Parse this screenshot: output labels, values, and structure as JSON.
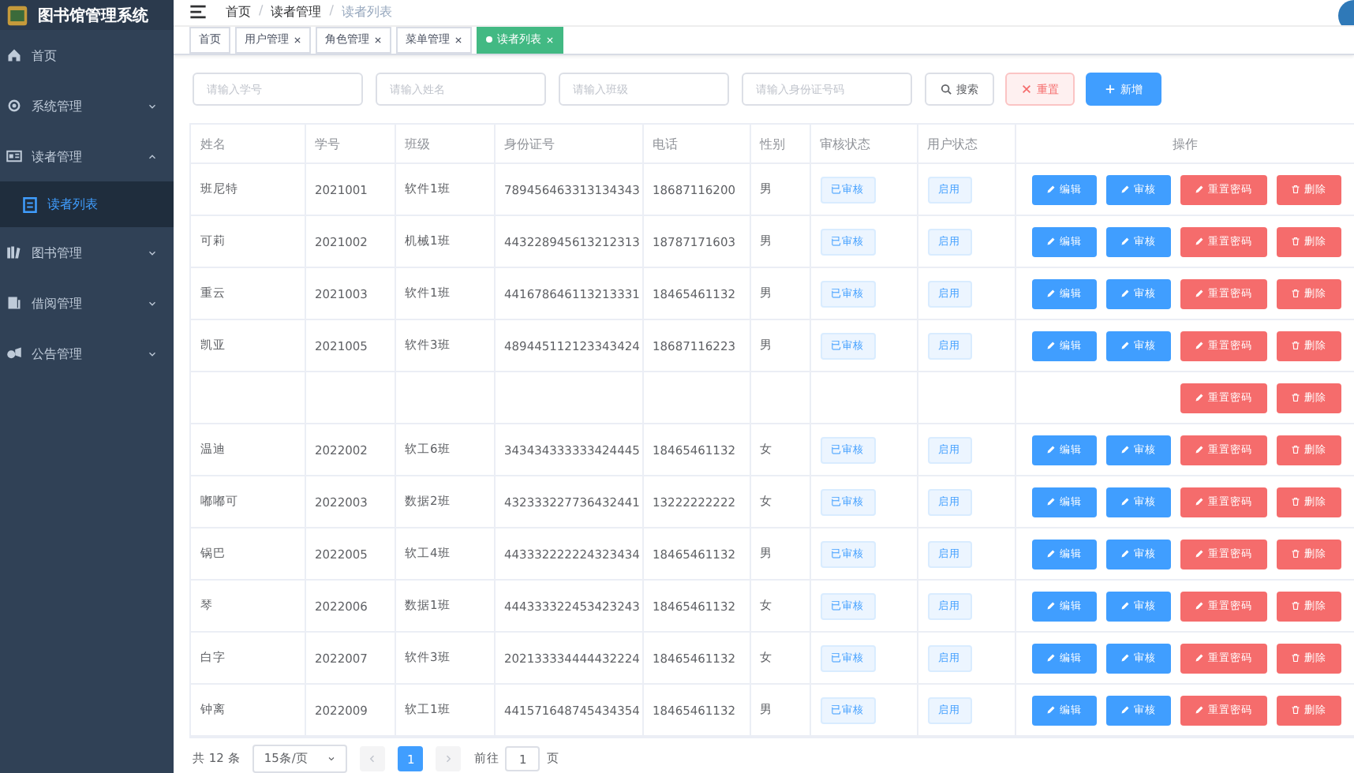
{
  "sidebar": {
    "title": "图书馆管理系统",
    "items": [
      {
        "label": "首页",
        "selected": false
      },
      {
        "label": "系统管理",
        "expanded": false,
        "selected": false
      },
      {
        "label": "读者管理",
        "expanded": true,
        "selected": false,
        "children": [
          {
            "label": "读者列表",
            "selected": true
          }
        ]
      },
      {
        "label": "图书管理",
        "expanded": false,
        "selected": false
      },
      {
        "label": "借阅管理",
        "expanded": false,
        "selected": false
      },
      {
        "label": "公告管理",
        "expanded": false,
        "selected": false
      }
    ]
  },
  "breadcrumb": [
    {
      "label": "首页"
    },
    {
      "separator": "/",
      "label": "读者管理"
    },
    {
      "separator": "/",
      "label": "读者列表"
    }
  ],
  "tabs": [
    {
      "label": "首页",
      "selected": false,
      "closable": false
    },
    {
      "label": "用户管理",
      "selected": false,
      "closable": true
    },
    {
      "label": "角色管理",
      "selected": false,
      "closable": true
    },
    {
      "label": "菜单管理",
      "selected": false,
      "closable": true
    },
    {
      "label": "读者列表",
      "selected": true,
      "closable": true
    }
  ],
  "search": {
    "fields": [
      {
        "placeholder": "请输入学号"
      },
      {
        "placeholder": "请输入姓名"
      },
      {
        "placeholder": "请输入班级"
      },
      {
        "placeholder": "请输入身份证号码"
      }
    ],
    "buttons": [
      {
        "kind": "search",
        "label": "搜索"
      },
      {
        "kind": "reset",
        "label": "重置"
      },
      {
        "kind": "add",
        "label": "新增"
      }
    ]
  },
  "table": {
    "columns": [
      "姓名",
      "学号",
      "班级",
      "身份证号",
      "电话",
      "性别",
      "审核状态",
      "用户状态",
      "操作"
    ],
    "rows": [
      {
        "cells": [
          "班尼特",
          "2021001",
          "软件1班",
          "789456463313134343",
          "18687116200",
          "男"
        ],
        "audit_status": "已审核",
        "user_status": "启用",
        "actions": [
          {
            "kind": "edit",
            "label": "编辑"
          },
          {
            "kind": "audit",
            "label": "审核"
          },
          {
            "kind": "reset",
            "label": "重置密码"
          },
          {
            "kind": "delete",
            "label": "删除"
          }
        ]
      },
      {
        "cells": [
          "可莉",
          "2021002",
          "机械1班",
          "443228945613212313",
          "18787171603",
          "男"
        ],
        "audit_status": "已审核",
        "user_status": "启用",
        "actions": [
          {
            "kind": "edit",
            "label": "编辑"
          },
          {
            "kind": "audit",
            "label": "审核"
          },
          {
            "kind": "reset",
            "label": "重置密码"
          },
          {
            "kind": "delete",
            "label": "删除"
          }
        ]
      },
      {
        "cells": [
          "重云",
          "2021003",
          "软件1班",
          "441678646113213331",
          "18465461132",
          "男"
        ],
        "audit_status": "已审核",
        "user_status": "启用",
        "actions": [
          {
            "kind": "edit",
            "label": "编辑"
          },
          {
            "kind": "audit",
            "label": "审核"
          },
          {
            "kind": "reset",
            "label": "重置密码"
          },
          {
            "kind": "delete",
            "label": "删除"
          }
        ]
      },
      {
        "cells": [
          "凯亚",
          "2021005",
          "软件3班",
          "489445112123343424",
          "18687116223",
          "男"
        ],
        "audit_status": "已审核",
        "user_status": "启用",
        "actions": [
          {
            "kind": "edit",
            "label": "编辑"
          },
          {
            "kind": "audit",
            "label": "审核"
          },
          {
            "kind": "reset",
            "label": "重置密码"
          },
          {
            "kind": "delete",
            "label": "删除"
          }
        ]
      },
      {
        "cells": [],
        "actions": [
          {
            "kind": "reset",
            "label": "重置密码"
          },
          {
            "kind": "delete",
            "label": "删除"
          }
        ]
      },
      {
        "cells": [
          "温迪",
          "2022002",
          "软工6班",
          "343434333333424445",
          "18465461132",
          "女"
        ],
        "audit_status": "已审核",
        "user_status": "启用",
        "actions": [
          {
            "kind": "edit",
            "label": "编辑"
          },
          {
            "kind": "audit",
            "label": "审核"
          },
          {
            "kind": "reset",
            "label": "重置密码"
          },
          {
            "kind": "delete",
            "label": "删除"
          }
        ]
      },
      {
        "cells": [
          "嘟嘟可",
          "2022003",
          "数据2班",
          "432333227736432441",
          "13222222222",
          "女"
        ],
        "audit_status": "已审核",
        "user_status": "启用",
        "actions": [
          {
            "kind": "edit",
            "label": "编辑"
          },
          {
            "kind": "audit",
            "label": "审核"
          },
          {
            "kind": "reset",
            "label": "重置密码"
          },
          {
            "kind": "delete",
            "label": "删除"
          }
        ]
      },
      {
        "cells": [
          "锅巴",
          "2022005",
          "软工4班",
          "443332222224323434",
          "18465461132",
          "男"
        ],
        "audit_status": "已审核",
        "user_status": "启用",
        "actions": [
          {
            "kind": "edit",
            "label": "编辑"
          },
          {
            "kind": "audit",
            "label": "审核"
          },
          {
            "kind": "reset",
            "label": "重置密码"
          },
          {
            "kind": "delete",
            "label": "删除"
          }
        ]
      },
      {
        "cells": [
          "琴",
          "2022006",
          "数据1班",
          "444333322453423243",
          "18465461132",
          "女"
        ],
        "audit_status": "已审核",
        "user_status": "启用",
        "actions": [
          {
            "kind": "edit",
            "label": "编辑"
          },
          {
            "kind": "audit",
            "label": "审核"
          },
          {
            "kind": "reset",
            "label": "重置密码"
          },
          {
            "kind": "delete",
            "label": "删除"
          }
        ]
      },
      {
        "cells": [
          "白字",
          "2022007",
          "软件3班",
          "202133334444432224",
          "18465461132",
          "女"
        ],
        "audit_status": "已审核",
        "user_status": "启用",
        "actions": [
          {
            "kind": "edit",
            "label": "编辑"
          },
          {
            "kind": "audit",
            "label": "审核"
          },
          {
            "kind": "reset",
            "label": "重置密码"
          },
          {
            "kind": "delete",
            "label": "删除"
          }
        ]
      },
      {
        "cells": [
          "钟离",
          "2022009",
          "软工1班",
          "441571648745434354",
          "18465461132",
          "男"
        ],
        "audit_status": "已审核",
        "user_status": "启用",
        "actions": [
          {
            "kind": "edit",
            "label": "编辑"
          },
          {
            "kind": "audit",
            "label": "审核"
          },
          {
            "kind": "reset",
            "label": "重置密码"
          },
          {
            "kind": "delete",
            "label": "删除"
          }
        ]
      }
    ]
  },
  "pagination": {
    "total": "共 12 条",
    "page_size": "15条/页",
    "pages": [
      {
        "label": "1",
        "selected": true
      }
    ],
    "goto_label": "前往",
    "goto_value": "1",
    "goto_suffix": "页"
  }
}
